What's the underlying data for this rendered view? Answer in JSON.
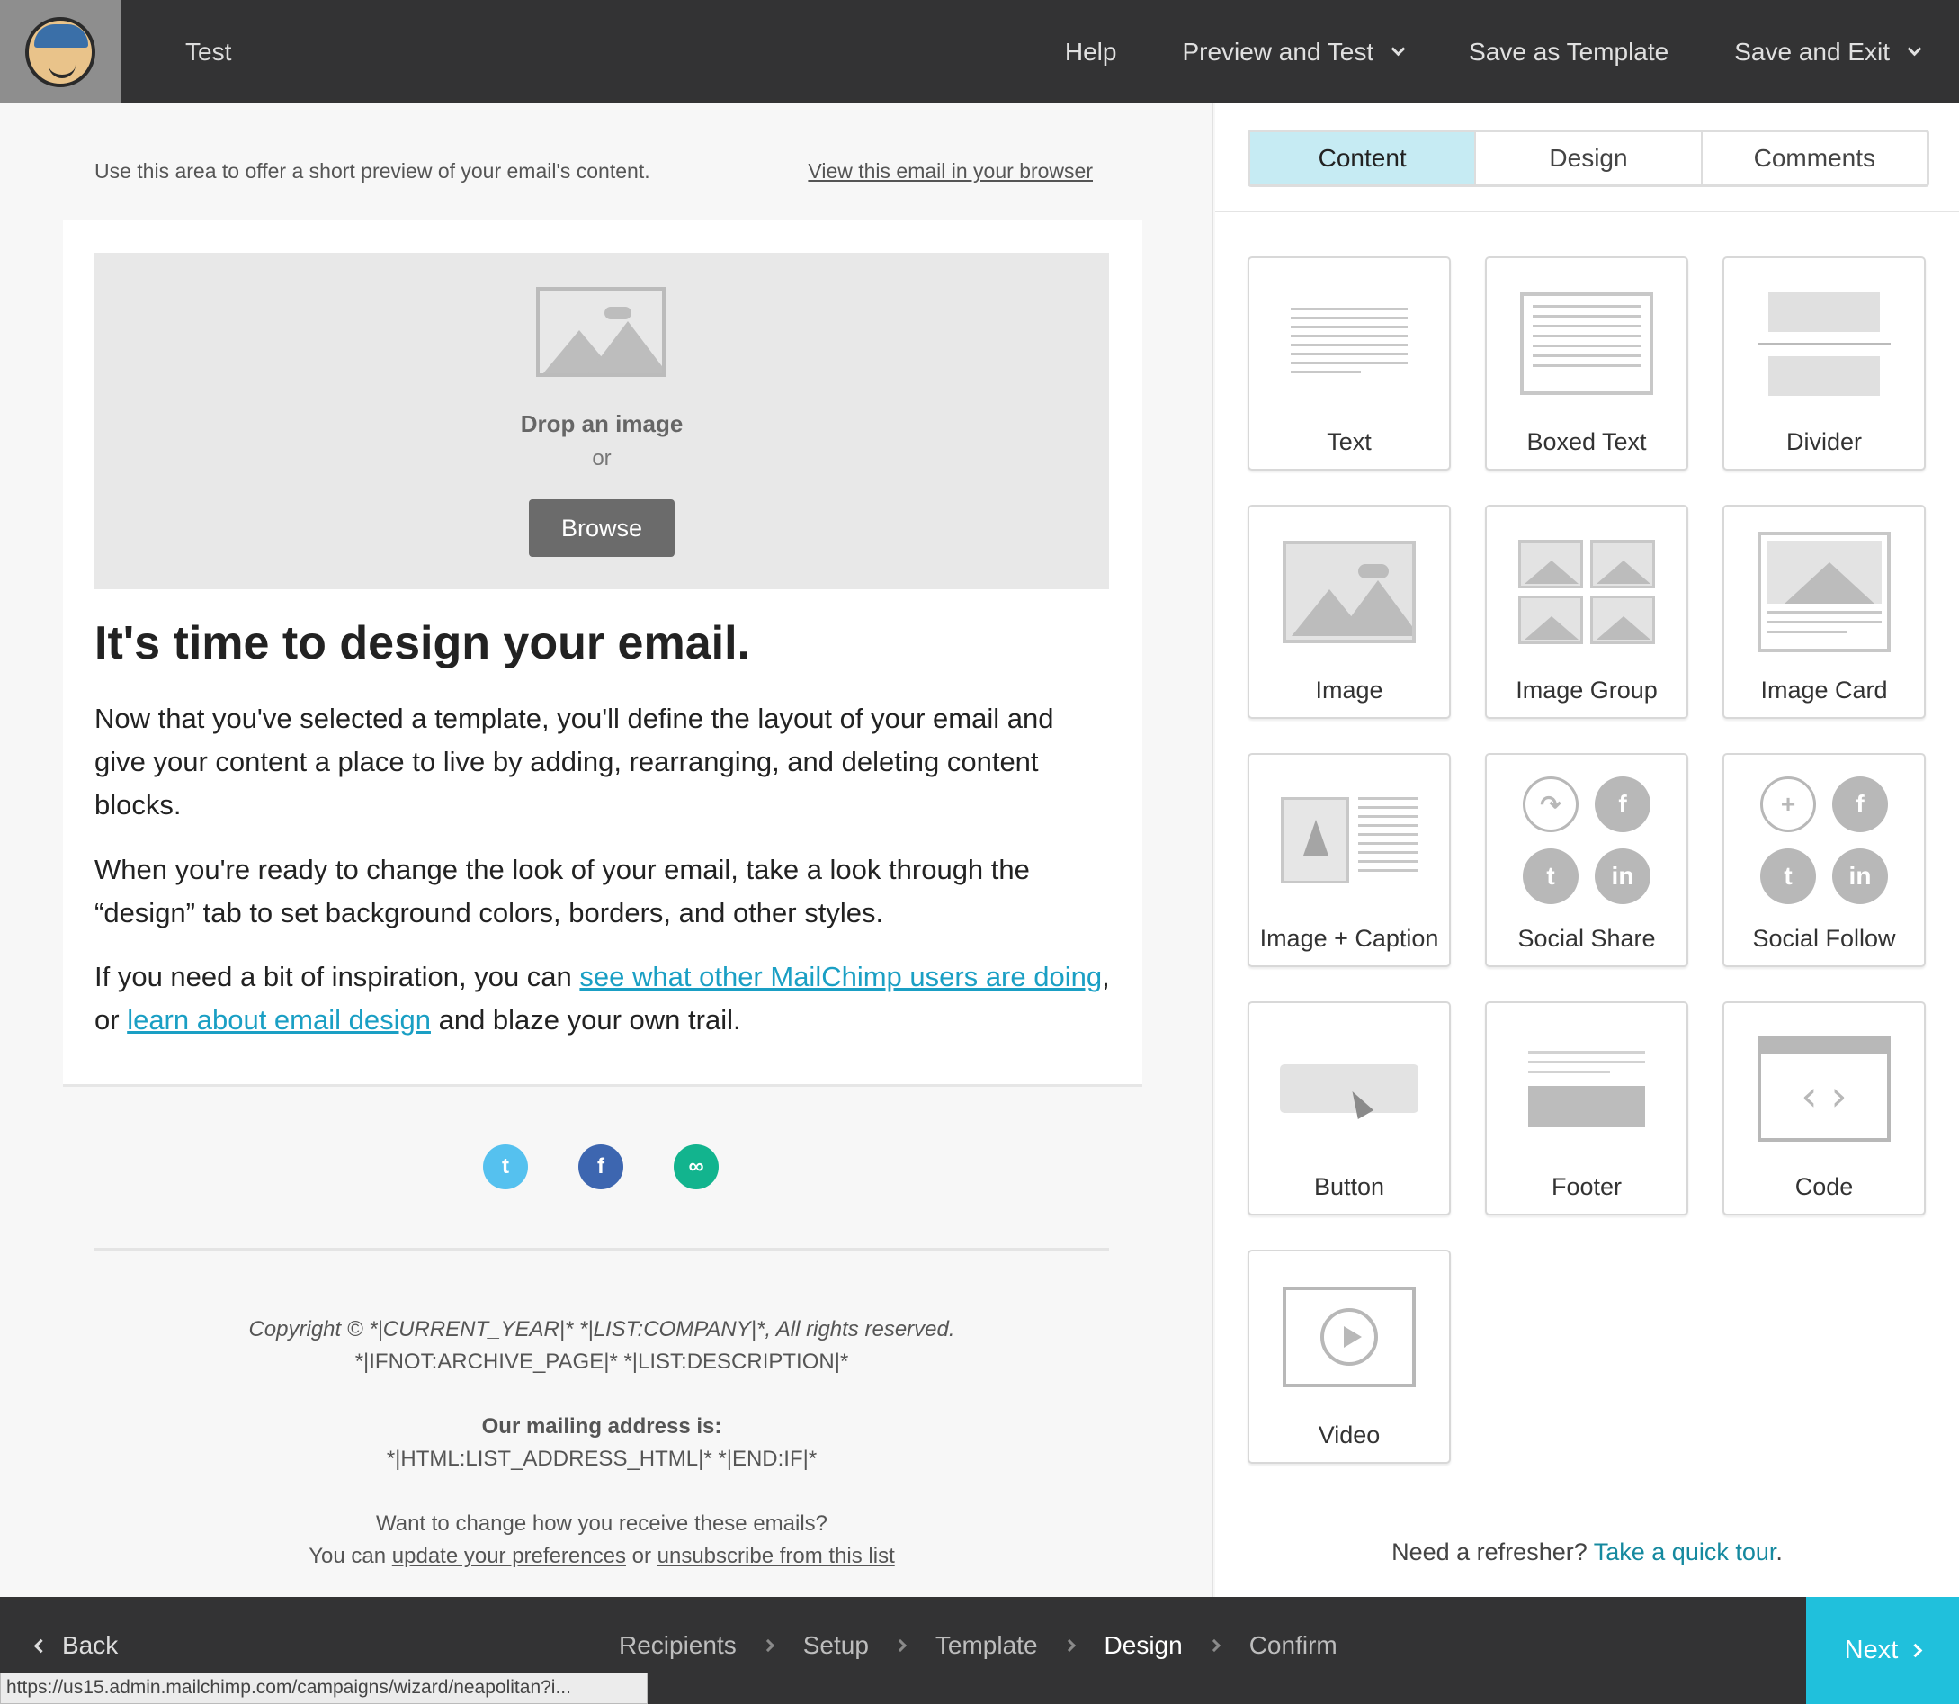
{
  "topbar": {
    "title": "Test",
    "nav": [
      "Help",
      "Preview and Test",
      "Save as Template",
      "Save and Exit"
    ]
  },
  "preview": {
    "preheader_text": "Use this area to offer a short preview of your email's content.",
    "view_in_browser": "View this email in your browser",
    "drop_label": "Drop an image",
    "drop_or": "or",
    "browse_label": "Browse",
    "headline": "It's time to design your email.",
    "p1": "Now that you've selected a template, you'll define the layout of your email and give your content a place to live by adding, rearranging, and deleting content blocks.",
    "p2": "When you're ready to change the look of your email, take a look through the “design” tab to set background colors, borders, and other styles.",
    "p3_pre": "If you need a bit of inspiration, you can ",
    "p3_link1": "see what other MailChimp users are doing",
    "p3_mid": ", or ",
    "p3_link2": "learn about email design",
    "p3_post": " and blaze your own trail."
  },
  "footer": {
    "copyright": "Copyright © *|CURRENT_YEAR|* *|LIST:COMPANY|*, All rights reserved.",
    "description": "*|IFNOT:ARCHIVE_PAGE|* *|LIST:DESCRIPTION|*",
    "address_label": "Our mailing address is:",
    "address_value": "*|HTML:LIST_ADDRESS_HTML|* *|END:IF|*",
    "change_q": "Want to change how you receive these emails?",
    "you_can": "You can ",
    "update_prefs": "update your preferences",
    "or": " or ",
    "unsubscribe": "unsubscribe from this list"
  },
  "panel": {
    "tabs": [
      "Content",
      "Design",
      "Comments"
    ],
    "blocks": [
      "Text",
      "Boxed Text",
      "Divider",
      "Image",
      "Image Group",
      "Image Card",
      "Image + Caption",
      "Social Share",
      "Social Follow",
      "Button",
      "Footer",
      "Code",
      "Video"
    ],
    "refresher_pre": "Need a refresher? ",
    "refresher_link": "Take a quick tour",
    "refresher_post": "."
  },
  "bottombar": {
    "back": "Back",
    "steps": [
      "Recipients",
      "Setup",
      "Template",
      "Design",
      "Confirm"
    ],
    "next": "Next"
  },
  "status_url": "https://us15.admin.mailchimp.com/campaigns/wizard/neapolitan?i..."
}
